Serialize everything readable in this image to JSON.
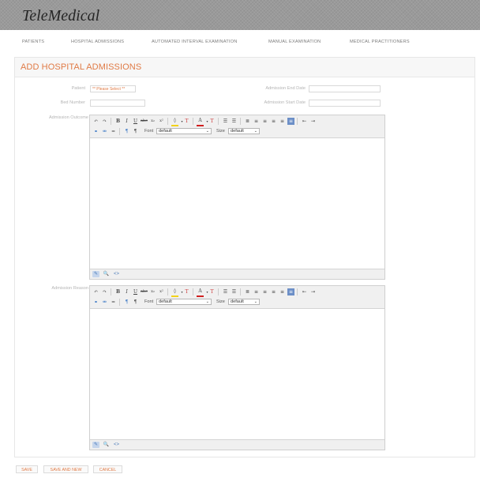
{
  "app": {
    "title": "TeleMedical"
  },
  "nav": {
    "items": [
      "PATIENTS",
      "HOSPITAL ADMISSIONS",
      "AUTOMATED INTERVAL EXAMINATION",
      "MANUAL EXAMINATION",
      "MEDICAL PRACTITIONERS"
    ]
  },
  "page": {
    "title": "ADD HOSPITAL ADMISSIONS"
  },
  "form": {
    "patient_label": "Patient",
    "patient_placeholder": "** Please Select **",
    "bed_label": "Bed Number",
    "end_date_label": "Admission End Date",
    "start_date_label": "Admission Start Date",
    "outcome_label": "Admission Outcome",
    "reason_label": "Admission Reason"
  },
  "editor": {
    "font_label": "Font",
    "font_value": "default",
    "size_label": "Size",
    "size_value": "default",
    "icons": [
      "undo-icon",
      "redo-icon",
      "bold-icon",
      "italic-icon",
      "underline-icon",
      "strikethrough-icon",
      "subscript-icon",
      "superscript-icon",
      "highlight-color-icon",
      "remove-highlight-icon",
      "text-color-icon",
      "remove-format-icon",
      "ordered-list-icon",
      "unordered-list-icon",
      "paragraph-icon",
      "align-left-icon",
      "align-center-icon",
      "align-right-icon",
      "align-justify-icon",
      "full-justify-icon",
      "outdent-icon",
      "indent-icon",
      "link-icon",
      "unlink-icon",
      "horizontal-rule-icon",
      "ltr-icon",
      "rtl-icon",
      "design-view-icon",
      "preview-icon",
      "html-view-icon"
    ],
    "glyphs": {
      "undo": "↶",
      "redo": "↷",
      "bold": "B",
      "italic": "I",
      "underline": "U",
      "strike": "abc",
      "sub": "x₂",
      "sup": "x²",
      "color": "A",
      "clear": "T",
      "ltr": "¶",
      "rtl": "¶",
      "design": "✎",
      "preview": "🔍",
      "html": "<>"
    }
  },
  "buttons": {
    "save": "SAVE",
    "save_new": "SAVE AND NEW",
    "cancel": "CANCEL"
  },
  "colors": {
    "accent": "#e07a45",
    "header": "#9a9a9a"
  }
}
